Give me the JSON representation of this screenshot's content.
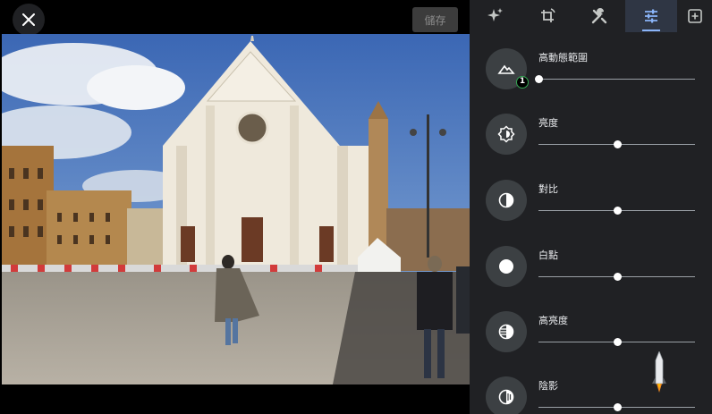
{
  "header": {
    "save_label": "儲存"
  },
  "tabs": [
    {
      "name": "auto-enhance",
      "icon": "sparkle-icon"
    },
    {
      "name": "crop-rotate",
      "icon": "crop-rotate-icon"
    },
    {
      "name": "tools",
      "icon": "tools-icon"
    },
    {
      "name": "adjust",
      "icon": "sliders-icon",
      "active": true
    },
    {
      "name": "markup",
      "icon": "add-frame-icon"
    }
  ],
  "adjustments": [
    {
      "label": "高動態範圍",
      "value": 0,
      "icon": "hdr-icon",
      "badge": "1"
    },
    {
      "label": "亮度",
      "value": 0.5,
      "icon": "brightness-icon"
    },
    {
      "label": "對比",
      "value": 0.5,
      "icon": "contrast-icon"
    },
    {
      "label": "白點",
      "value": 0.5,
      "icon": "white-point-icon"
    },
    {
      "label": "高亮度",
      "value": 0.5,
      "icon": "highlights-icon"
    },
    {
      "label": "陰影",
      "value": 0.5,
      "icon": "shadows-icon"
    }
  ],
  "colors": {
    "panel_bg": "#202124",
    "active_tab_bg": "#2f3644",
    "accent": "#8ab4f8",
    "badge_ring": "#34a853"
  }
}
